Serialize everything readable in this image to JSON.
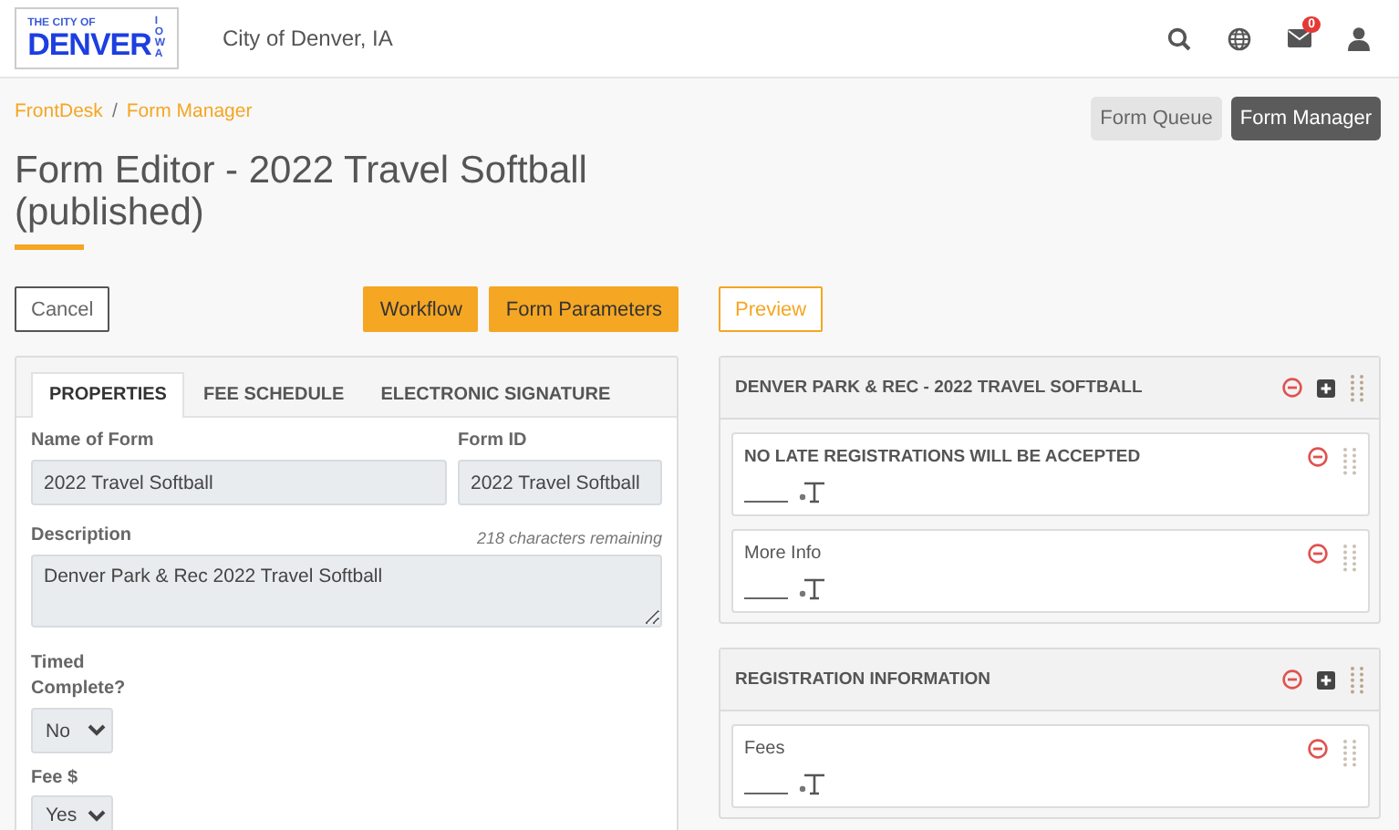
{
  "header": {
    "logo": {
      "line_1": "THE CITY OF",
      "line_2": "DENVER",
      "line_3": "IOWA"
    },
    "site_name": "City of Denver, IA",
    "mail_badge": "0"
  },
  "breadcrumb": [
    "FrontDesk",
    "Form Manager"
  ],
  "breadcrumb_separator": "/",
  "top_buttons": [
    {
      "label": "Form Queue",
      "selected": false
    },
    {
      "label": "Form Manager",
      "selected": true
    }
  ],
  "title": "Form Editor - 2022 Travel Softball (published)",
  "actions": {
    "cancel": "Cancel",
    "workflow": "Workflow",
    "parameters": "Form Parameters",
    "preview": "Preview"
  },
  "tabs": [
    {
      "label": "PROPERTIES",
      "selected": true
    },
    {
      "label": "FEE SCHEDULE",
      "selected": false
    },
    {
      "label": "ELECTRONIC SIGNATURE",
      "selected": false
    }
  ],
  "properties": {
    "name_label": "Name of Form",
    "name_value": "2022 Travel Softball",
    "id_label": "Form ID",
    "id_value": "2022 Travel Softball",
    "description_label": "Description",
    "remaining": "218 characters remaining",
    "description_value": "Denver Park & Rec 2022 Travel Softball",
    "timed_label": "Timed Complete?",
    "timed_value": "No",
    "fee_label": "Fee $",
    "fee_value": "Yes"
  },
  "sections": [
    {
      "title": "DENVER PARK & REC - 2022 TRAVEL SOFTBALL",
      "fields": [
        {
          "label": "NO LATE REGISTRATIONS WILL BE ACCEPTED",
          "bold": true
        },
        {
          "label": "More Info",
          "bold": false
        }
      ]
    },
    {
      "title": "REGISTRATION INFORMATION",
      "fields": [
        {
          "label": "Fees",
          "bold": false
        }
      ]
    }
  ]
}
